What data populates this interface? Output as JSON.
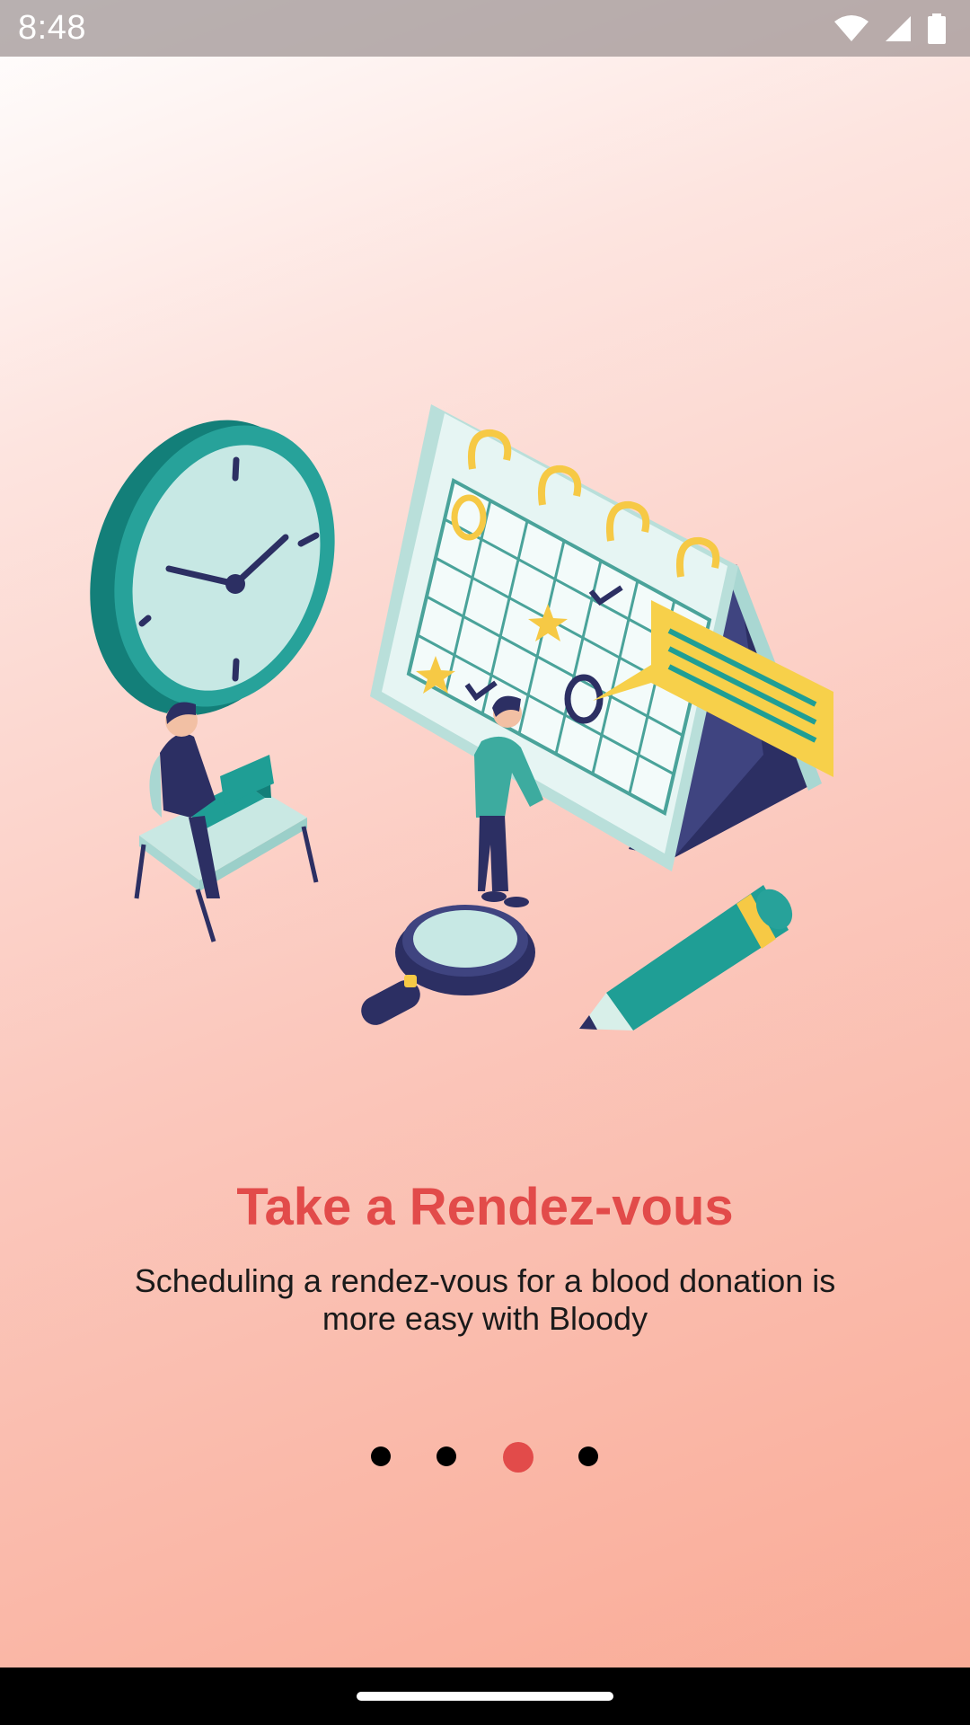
{
  "status_bar": {
    "time": "8:48",
    "icons": [
      "wifi-icon",
      "signal-icon",
      "battery-icon"
    ]
  },
  "illustration": {
    "subject": "calendar-scheduling-illustration",
    "elements": [
      "clock",
      "calendar",
      "person-at-laptop",
      "person-standing",
      "magnifying-glass",
      "pencil",
      "speech-bubble"
    ]
  },
  "onboarding": {
    "title": "Take a Rendez-vous",
    "description": "Scheduling a rendez-vous for a blood donation is more easy with Bloody"
  },
  "pager": {
    "page_count": 4,
    "current_page": 3
  },
  "colors": {
    "accent": "#e24b4a",
    "dot_inactive": "#000000",
    "teal": "#1f9e95",
    "navy": "#2c2f63",
    "yellow": "#f6c945"
  }
}
